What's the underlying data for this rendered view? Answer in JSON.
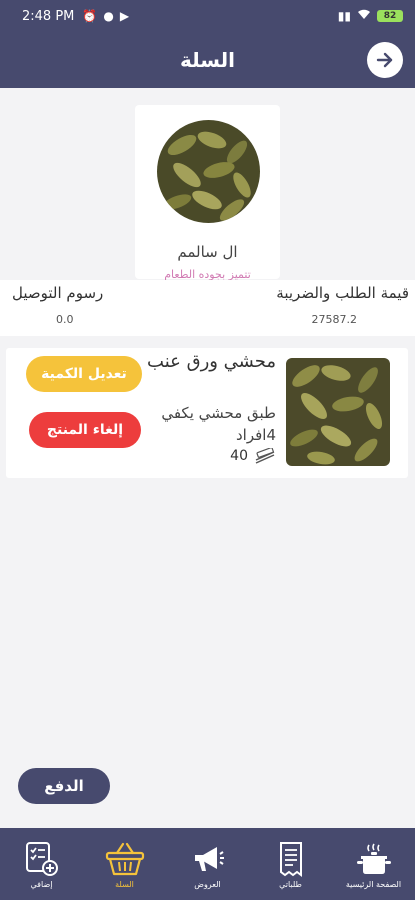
{
  "status": {
    "time": "2:48 PM",
    "battery": "82"
  },
  "header": {
    "title": "السلة"
  },
  "store": {
    "name": "ال سالمم",
    "slogan": "تتميز بجوده الطعام"
  },
  "summary": {
    "order_total_label": "قيمة الطلب والضريبة",
    "order_total_value": "27587.2",
    "delivery_label": "رسوم التوصيل",
    "delivery_value": "0.0"
  },
  "cart_item": {
    "name": "محشي ورق عنب",
    "description": "طبق محشي يكفي 4افراد",
    "quantity": "40",
    "edit_label": "تعديل الكمية",
    "cancel_label": "إلغاء المنتج"
  },
  "pay_label": "الدفع",
  "nav": {
    "items": [
      {
        "label": "إضافي",
        "icon": "checklist-add-icon"
      },
      {
        "label": "السلة",
        "icon": "basket-icon",
        "active": true
      },
      {
        "label": "العروض",
        "icon": "megaphone-icon"
      },
      {
        "label": "طلباتي",
        "icon": "receipt-icon"
      },
      {
        "label": "الصفحة الرئيسية",
        "icon": "cooking-pot-icon"
      }
    ]
  },
  "colors": {
    "primary": "#474a6e",
    "accent": "#f5c33b",
    "danger": "#ed3d3d",
    "slogan": "#d17bb3"
  }
}
